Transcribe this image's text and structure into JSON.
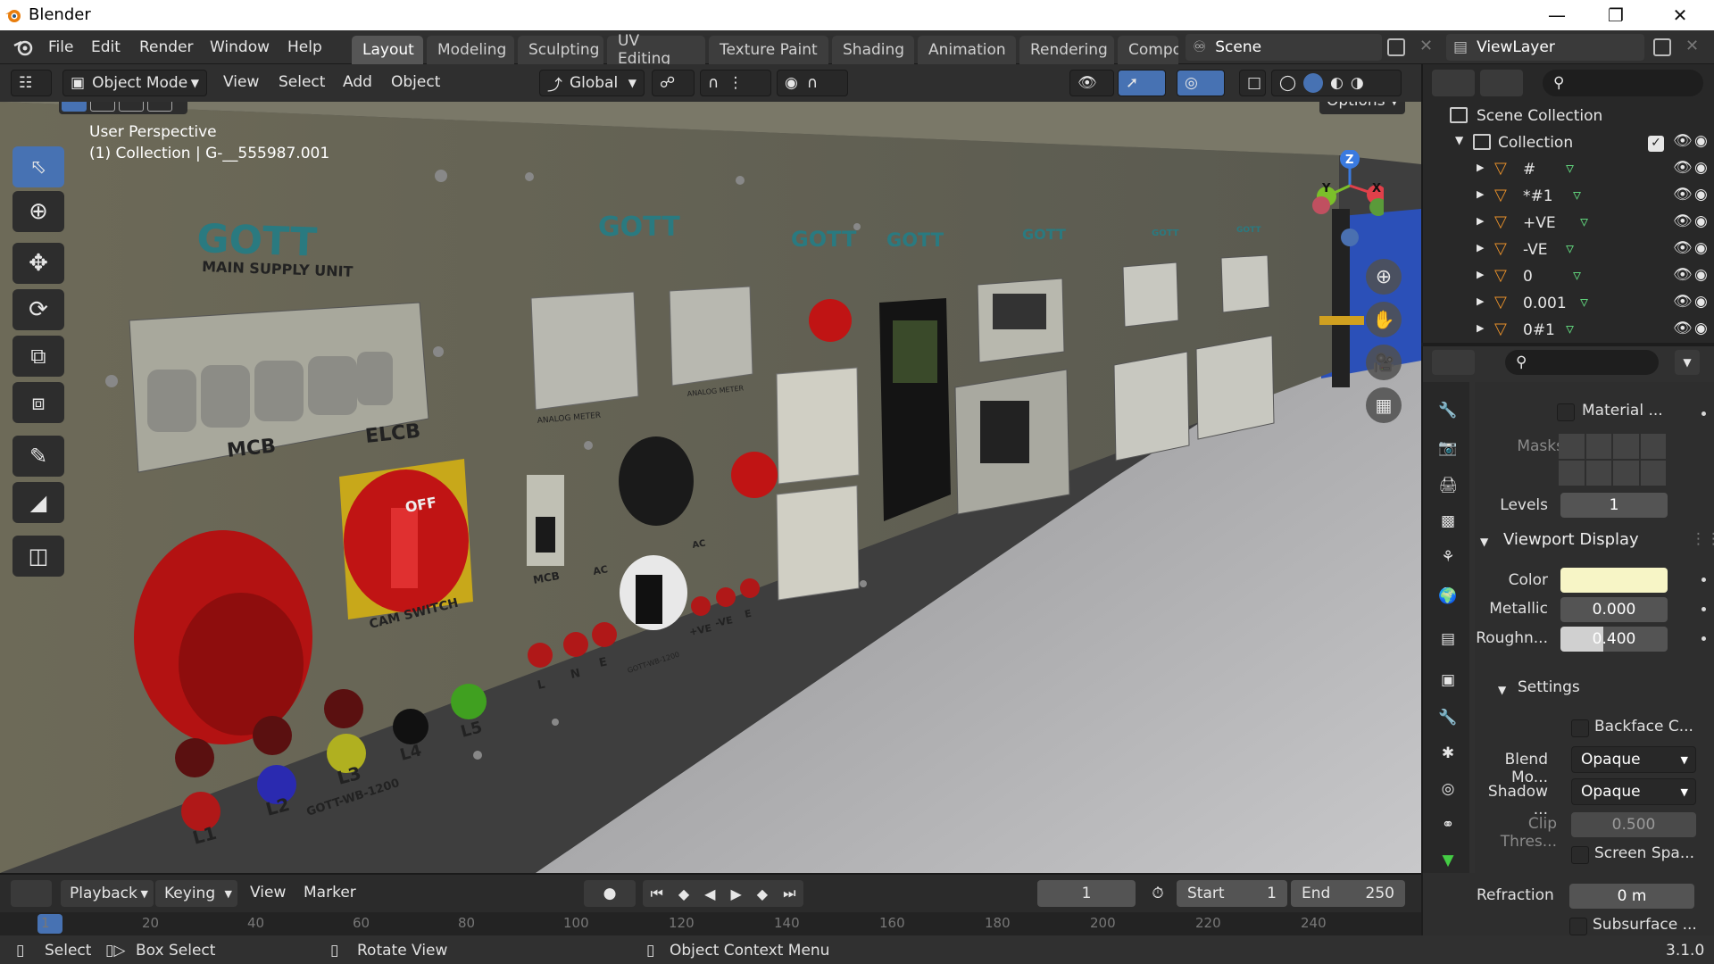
{
  "app": {
    "title": "Blender",
    "version": "3.1.0"
  },
  "menu": [
    "File",
    "Edit",
    "Render",
    "Window",
    "Help"
  ],
  "workspaces": [
    "Layout",
    "Modeling",
    "Sculpting",
    "UV Editing",
    "Texture Paint",
    "Shading",
    "Animation",
    "Rendering",
    "Compo"
  ],
  "scene": {
    "name": "Scene",
    "view_layer": "ViewLayer"
  },
  "viewport_header": {
    "mode": "Object Mode",
    "menus": [
      "View",
      "Select",
      "Add",
      "Object"
    ],
    "transform": "Global",
    "options": "Options"
  },
  "viewport": {
    "perspective": "User Perspective",
    "collection_info": "(1) Collection | G-__555987.001",
    "axes": {
      "z": "Z",
      "y": "Y",
      "x": "X"
    }
  },
  "model_labels": {
    "brand": "GOTT",
    "main_supply": "MAIN SUPPLY UNIT",
    "mcb": "MCB",
    "elcb": "ELCB",
    "off": "OFF",
    "cam_switch": "CAM SWITCH",
    "phases": [
      "L1",
      "L2",
      "L3",
      "L4",
      "L5"
    ],
    "model_code": "GOTT-WB-1200",
    "analog_meter": "ANALOG METER",
    "ac": "AC",
    "lne": [
      "L",
      "N",
      "E"
    ],
    "dc": [
      "+VE",
      "-VE",
      "E"
    ]
  },
  "outliner": {
    "root": "Scene Collection",
    "collection": "Collection",
    "items": [
      "#",
      "*#1",
      "+VE",
      "-VE",
      "0",
      "0.001",
      "0#1"
    ]
  },
  "properties": {
    "material_label": "Material ...",
    "masks": "Masks",
    "levels_label": "Levels",
    "levels_value": "1",
    "viewport_display": "Viewport Display",
    "color_label": "Color",
    "color_value": "#f7f5c6",
    "metallic_label": "Metallic",
    "metallic_value": "0.000",
    "roughness_label": "Roughn...",
    "roughness_value": "0.400",
    "settings": "Settings",
    "backface": "Backface C...",
    "blend_label": "Blend Mo...",
    "blend_value": "Opaque",
    "shadow_label": "Shadow ...",
    "shadow_value": "Opaque",
    "clip_label": "Clip Thres...",
    "clip_value": "0.500",
    "screen_space": "Screen Spa...",
    "refraction_label": "Refraction",
    "refraction_value": "0 m",
    "subsurface": "Subsurface ..."
  },
  "timeline": {
    "menus": [
      "Playback",
      "Keying",
      "View",
      "Marker"
    ],
    "current_frame": "1",
    "start_label": "Start",
    "start_value": "1",
    "end_label": "End",
    "end_value": "250",
    "ticks": [
      "1",
      "20",
      "40",
      "60",
      "80",
      "100",
      "120",
      "140",
      "160",
      "180",
      "200",
      "220",
      "240"
    ]
  },
  "status": {
    "select": "Select",
    "box_select": "Box Select",
    "rotate": "Rotate View",
    "context": "Object Context Menu"
  }
}
